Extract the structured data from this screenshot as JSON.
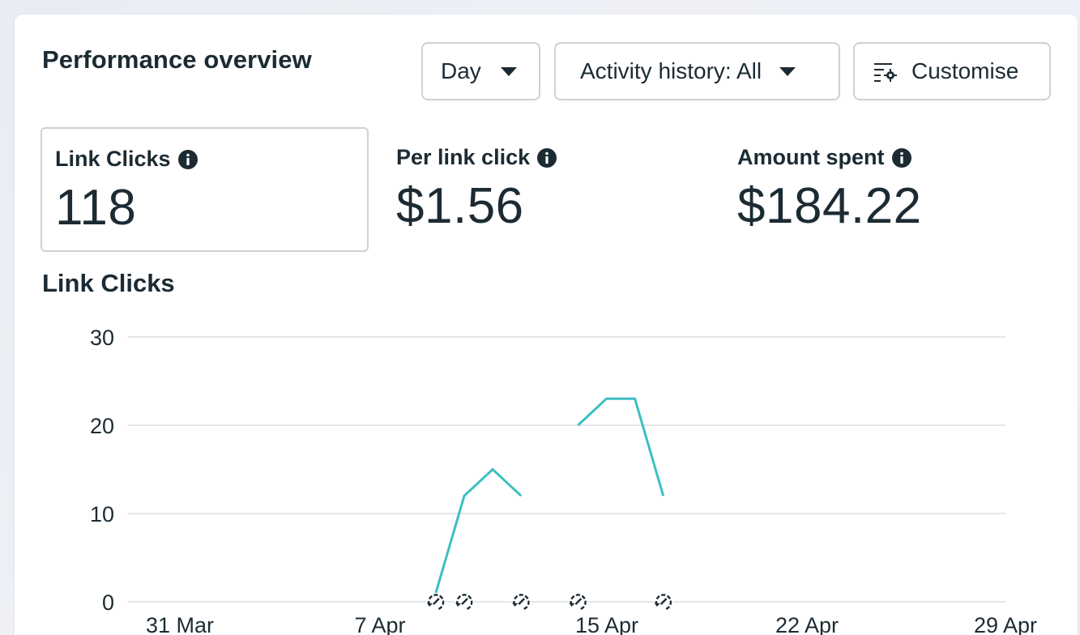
{
  "header": {
    "title": "Performance overview",
    "day_label": "Day",
    "activity_label": "Activity history: All",
    "customise_label": "Customise"
  },
  "metrics": [
    {
      "label": "Link Clicks",
      "value": "118"
    },
    {
      "label": "Per link click",
      "value": "$1.56"
    },
    {
      "label": "Amount spent",
      "value": "$184.22"
    }
  ],
  "chart_title": "Link Clicks",
  "colors": {
    "line": "#3cbfc2",
    "text": "#1c2b33",
    "grid": "#e4e6eb",
    "border": "#ced0d4"
  },
  "icons": [
    "caret-down-icon",
    "customise-settings-icon",
    "info-icon",
    "activity-history-icon"
  ],
  "chart_data": {
    "type": "line",
    "title": "Link Clicks",
    "xlabel": "",
    "ylabel": "",
    "ylim": [
      0,
      30
    ],
    "yticks": [
      "0",
      "10",
      "20",
      "30"
    ],
    "xticks": [
      "31 Mar",
      "7 Apr",
      "15 Apr",
      "22 Apr",
      "29 Apr"
    ],
    "grid": true,
    "segments": [
      {
        "x": [
          "9 Apr",
          "10 Apr",
          "11 Apr",
          "12 Apr"
        ],
        "y": [
          1,
          12,
          15,
          12
        ]
      },
      {
        "x": [
          "14 Apr",
          "15 Apr",
          "16 Apr",
          "17 Apr"
        ],
        "y": [
          20,
          23,
          23,
          12
        ]
      }
    ],
    "activity_markers": [
      "9 Apr",
      "10 Apr",
      "12 Apr",
      "14 Apr",
      "17 Apr"
    ]
  }
}
